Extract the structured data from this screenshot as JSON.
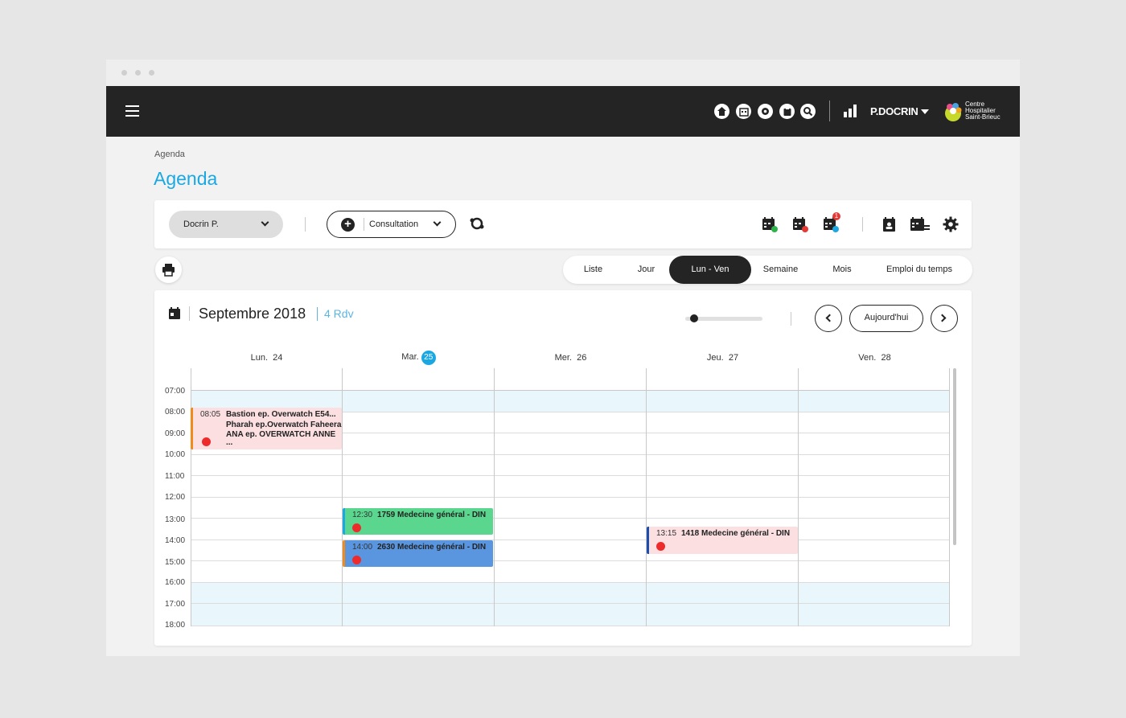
{
  "topbar": {
    "icons": [
      "home-icon",
      "calendar-grid-icon",
      "settings-icon",
      "clipboard-icon",
      "search-icon"
    ],
    "username": "P.DOCRIN",
    "logo": {
      "line1": "Centre",
      "line2": "Hospitalier",
      "line3": "Saint-Brieuc"
    }
  },
  "breadcrumb": "Agenda",
  "page_title": "Agenda",
  "toolbar": {
    "doctor_select": "Docrin P.",
    "consult_select": "Consultation",
    "notification_count": "1"
  },
  "view_tabs": [
    {
      "label": "Liste",
      "active": false
    },
    {
      "label": "Jour",
      "active": false
    },
    {
      "label": "Lun - Ven",
      "active": true
    },
    {
      "label": "Semaine",
      "active": false
    },
    {
      "label": "Mois",
      "active": false
    },
    {
      "label": "Emploi du temps",
      "active": false
    }
  ],
  "calendar": {
    "month": "Septembre 2018",
    "rdv_count": "4 Rdv",
    "today_label": "Aujourd'hui",
    "days": [
      {
        "name": "Lun.",
        "num": "24",
        "today": false
      },
      {
        "name": "Mar.",
        "num": "25",
        "today": true
      },
      {
        "name": "Mer.",
        "num": "26",
        "today": false
      },
      {
        "name": "Jeu.",
        "num": "27",
        "today": false
      },
      {
        "name": "Ven.",
        "num": "28",
        "today": false
      }
    ],
    "hours": [
      "07:00",
      "08:00",
      "09:00",
      "10:00",
      "11:00",
      "12:00",
      "13:00",
      "14:00",
      "15:00",
      "16:00",
      "17:00",
      "18:00"
    ],
    "events": [
      {
        "time": "08:05",
        "lines": [
          "Bastion ep. Overwatch E54...",
          "Pharah ep.Overwatch Faheera",
          "ANA ep. OVERWATCH ANNE",
          "..."
        ],
        "bg": "#fbdfe1",
        "stripe": "#f08a1c"
      },
      {
        "time": "12:30",
        "lines": [
          "1759 Medecine général - DIN"
        ],
        "bg": "#5bd68f",
        "stripe": "#1ba8e2"
      },
      {
        "time": "14:00",
        "lines": [
          "2630 Medecine général - DIN"
        ],
        "bg": "#5a96e0",
        "stripe": "#f08a1c"
      },
      {
        "time": "13:15",
        "lines": [
          "1418 Medecine général - DIN"
        ],
        "bg": "#fbdfe1",
        "stripe": "#1a4fb0"
      }
    ]
  }
}
